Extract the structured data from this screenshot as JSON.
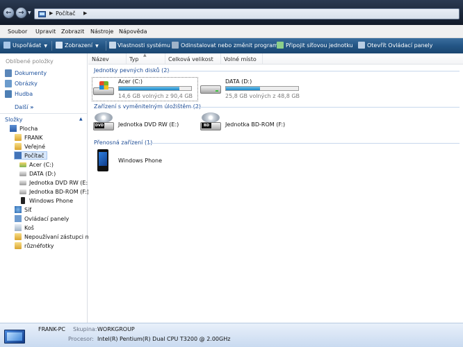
{
  "address": {
    "path_label": "Počítač"
  },
  "menu": [
    "Soubor",
    "Upravit",
    "Zobrazit",
    "Nástroje",
    "Nápověda"
  ],
  "toolbar": {
    "organize": "Uspořádat",
    "views": "Zobrazení",
    "system_properties": "Vlastnosti systému",
    "uninstall": "Odinstalovat nebo změnit program",
    "map_drive": "Připojit síťovou jednotku",
    "control_panel": "Otevřít Ovládací panely"
  },
  "sidebar": {
    "favorites_title": "Oblíbené položky",
    "favorites": [
      "Dokumenty",
      "Obrázky",
      "Hudba"
    ],
    "more": "Další",
    "folders_title": "Složky",
    "tree": [
      "Plocha",
      "FRANK",
      "Veřejné",
      "Počítač",
      "Acer (C:)",
      "DATA (D:)",
      "Jednotka DVD RW (E:)",
      "Jednotka BD-ROM (F:)",
      "Windows Phone",
      "Síť",
      "Ovládací panely",
      "Koš",
      "Nepoužívaní zástupci na",
      "různéfotky"
    ]
  },
  "columns": [
    "Název",
    "Typ",
    "Celková velikost",
    "Volné místo"
  ],
  "groups": {
    "hard_drives": "Jednotky pevných disků (2)",
    "removable": "Zařízení s vyměnitelným úložištěm (2)",
    "portable": "Přenosná zařízení (1)"
  },
  "drives": [
    {
      "name": "Acer (C:)",
      "free_text": "14,6 GB volných z 90,4 GB",
      "used_fraction": 0.84
    },
    {
      "name": "DATA (D:)",
      "free_text": "25,8 GB volných z 48,8 GB",
      "used_fraction": 0.47
    }
  ],
  "removable": [
    "Jednotka DVD RW (E:)",
    "Jednotka BD-ROM (F:)"
  ],
  "dvd_badge": "DVD",
  "bd_badge": "BD",
  "portable": [
    "Windows Phone"
  ],
  "status": {
    "pc_name": "FRANK-PC",
    "workgroup_key": "Skupina:",
    "workgroup_val": "WORKGROUP",
    "cpu_key": "Procesor:",
    "cpu_val": "Intel(R) Pentium(R) Dual  CPU  T3200  @ 2.00GHz"
  }
}
